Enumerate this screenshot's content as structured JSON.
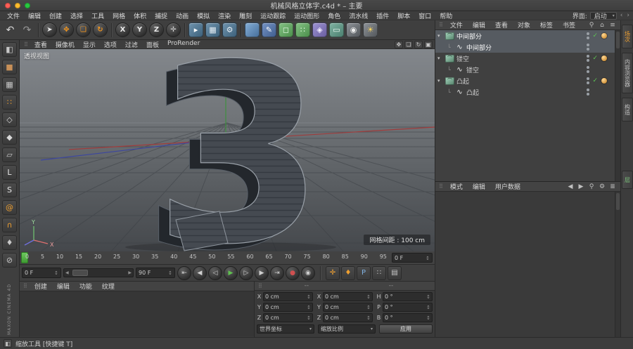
{
  "window": {
    "title": "机械风格立体字.c4d * – 主要",
    "status_tool": "缩放工具 [快捷键 T]",
    "traffic_lights": [
      "#ff5f57",
      "#febc2e",
      "#28c840"
    ]
  },
  "menubar": {
    "items": [
      "文件",
      "编辑",
      "创建",
      "选择",
      "工具",
      "网格",
      "体积",
      "捕捉",
      "动画",
      "模拟",
      "渲染",
      "雕刻",
      "运动跟踪",
      "运动图形",
      "角色",
      "流水线",
      "插件",
      "脚本",
      "窗口",
      "帮助"
    ],
    "interface_label": "界面:",
    "interface_value": "启动"
  },
  "toolbar": {
    "undo": [
      {
        "name": "undo-button",
        "glyph": "↶",
        "color": "#d8d8d8",
        "kind": "flat"
      },
      {
        "name": "redo-button",
        "glyph": "↷",
        "color": "#999999",
        "kind": "flat"
      }
    ],
    "tools": [
      {
        "name": "live-selection-button",
        "glyph": "➤",
        "color": "#e8e8e8",
        "kind": "round"
      },
      {
        "name": "move-button",
        "glyph": "✥",
        "color": "#f0941e",
        "kind": "round"
      },
      {
        "name": "scale-button",
        "glyph": "❏",
        "color": "#f0941e",
        "kind": "round"
      },
      {
        "name": "rotate-button",
        "glyph": "↻",
        "color": "#f0941e",
        "kind": "round"
      }
    ],
    "axis": [
      {
        "name": "x-lock-button",
        "glyph": "X",
        "color": "#e8e8e8",
        "kind": "round"
      },
      {
        "name": "y-lock-button",
        "glyph": "Y",
        "color": "#e8e8e8",
        "kind": "round"
      },
      {
        "name": "z-lock-button",
        "glyph": "Z",
        "color": "#e8e8e8",
        "kind": "round"
      },
      {
        "name": "coord-system-button",
        "glyph": "✛",
        "color": "#d0d0d0",
        "kind": "round"
      }
    ],
    "render": [
      {
        "name": "render-view-button",
        "glyph": "▸",
        "color": "#ffffff",
        "bg": "linear-gradient(135deg,#6f93ad,#3d617b)",
        "kind": "obj"
      },
      {
        "name": "render-picture-button",
        "glyph": "▦",
        "color": "#e6eef4",
        "bg": "linear-gradient(135deg,#6f93ad,#3d617b)",
        "kind": "obj"
      },
      {
        "name": "render-settings-button",
        "glyph": "⚙",
        "color": "#e6eef4",
        "bg": "linear-gradient(135deg,#6f93ad,#3d617b)",
        "kind": "obj"
      }
    ],
    "objects": [
      {
        "name": "add-cube-button",
        "glyph": "",
        "color": "#ffffff",
        "bg": "linear-gradient(135deg,#84aed6,#48709c)",
        "kind": "obj"
      },
      {
        "name": "add-spline-button",
        "glyph": "✎",
        "color": "#ffffff",
        "bg": "linear-gradient(135deg,#7492c4,#415f90)",
        "kind": "obj"
      },
      {
        "name": "add-subdivision-button",
        "glyph": "◻",
        "color": "#eaffea",
        "bg": "linear-gradient(135deg,#84c284,#4c8f4c)",
        "kind": "obj"
      },
      {
        "name": "add-array-button",
        "glyph": "∷",
        "color": "#eaffea",
        "bg": "linear-gradient(135deg,#84c284,#4c8f4c)",
        "kind": "obj"
      },
      {
        "name": "add-deformer-button",
        "glyph": "◈",
        "color": "#f2ecff",
        "bg": "linear-gradient(135deg,#9d92d2,#6a5fa2)",
        "kind": "obj"
      },
      {
        "name": "add-environment-button",
        "glyph": "▭",
        "color": "#eaf8f2",
        "bg": "linear-gradient(135deg,#7fb3a2,#4c8070)",
        "kind": "obj"
      },
      {
        "name": "add-camera-button",
        "glyph": "◉",
        "color": "#ececec",
        "bg": "linear-gradient(135deg,#8d9297,#54585c)",
        "kind": "obj"
      },
      {
        "name": "add-light-button",
        "glyph": "☀",
        "color": "#ffd75a",
        "bg": "linear-gradient(135deg,#8d9297,#54585c)",
        "kind": "obj"
      }
    ]
  },
  "sidebar": {
    "tools": [
      {
        "name": "make-editable-button",
        "glyph": "◧",
        "color": "#c8c8c8"
      },
      {
        "name": "model-mode-button",
        "glyph": "■",
        "color": "#c89058"
      },
      {
        "name": "texture-mode-button",
        "glyph": "▦",
        "color": "#c8c8c8"
      },
      {
        "name": "points-mode-button",
        "glyph": "∷",
        "color": "#f0a030"
      },
      {
        "name": "edges-mode-button",
        "glyph": "◇",
        "color": "#d8d8d8"
      },
      {
        "name": "polygons-mode-button",
        "glyph": "◆",
        "color": "#d8d8d8"
      },
      {
        "name": "workplane-mode-button",
        "glyph": "▱",
        "color": "#c8c8c8"
      },
      {
        "name": "axis-mode-button",
        "glyph": "L",
        "color": "#e8e8e8"
      },
      {
        "name": "soft-selection-button",
        "glyph": "S",
        "color": "#e8e8e8"
      },
      {
        "name": "tweak-mode-button",
        "glyph": "@",
        "color": "#f0a030"
      },
      {
        "name": "snap-button",
        "glyph": "∩",
        "color": "#f0a030"
      },
      {
        "name": "keyframe-mode-button",
        "glyph": "♦",
        "color": "#c8c8c8"
      },
      {
        "name": "lock-button",
        "glyph": "⊘",
        "color": "#c8c8c8"
      }
    ]
  },
  "viewport": {
    "menu": [
      "查看",
      "摄像机",
      "显示",
      "选项",
      "过滤",
      "面板",
      "ProRender"
    ],
    "nav": [
      {
        "name": "pan-view-icon",
        "glyph": "✥"
      },
      {
        "name": "zoom-view-icon",
        "glyph": "❏"
      },
      {
        "name": "rotate-view-icon",
        "glyph": "↻"
      },
      {
        "name": "maximize-view-icon",
        "glyph": "▣"
      }
    ],
    "label": "透视视图",
    "grid_info": "网格间距 : 100 cm",
    "model_char": "3",
    "axis": {
      "x": "X",
      "y": "Y"
    }
  },
  "timeline": {
    "ticks": [
      "0",
      "5",
      "10",
      "15",
      "20",
      "25",
      "30",
      "35",
      "40",
      "45",
      "50",
      "55",
      "60",
      "65",
      "70",
      "75",
      "80",
      "85",
      "90",
      "95"
    ],
    "frame_box": "0 F",
    "current": "0 F",
    "range_end": "90 F",
    "transport": [
      {
        "name": "goto-start-button",
        "glyph": "⇤",
        "color": "#d0d0d0"
      },
      {
        "name": "prev-key-button",
        "glyph": "◀",
        "color": "#d0d0d0"
      },
      {
        "name": "prev-frame-button",
        "glyph": "◁",
        "color": "#d0d0d0"
      },
      {
        "name": "play-button",
        "glyph": "▶",
        "color": "#5fc14f"
      },
      {
        "name": "next-frame-button",
        "glyph": "▷",
        "color": "#d0d0d0"
      },
      {
        "name": "next-key-button",
        "glyph": "▶",
        "color": "#d0d0d0"
      },
      {
        "name": "goto-end-button",
        "glyph": "⇥",
        "color": "#d0d0d0"
      },
      {
        "name": "record-objects-button",
        "glyph": "●",
        "color": "#d05050"
      },
      {
        "name": "autokey-button",
        "glyph": "◉",
        "color": "#d0d0d0"
      }
    ],
    "key_tools": [
      {
        "name": "record-position-button",
        "glyph": "✛",
        "color": "#f0a030"
      },
      {
        "name": "record-key-button",
        "glyph": "♦",
        "color": "#f0a030"
      },
      {
        "name": "pla-button",
        "glyph": "P",
        "color": "#7fb0e0"
      },
      {
        "name": "keyframe-selection-button",
        "glyph": "∷",
        "color": "#c8c8c8"
      },
      {
        "name": "motion-clip-button",
        "glyph": "▤",
        "color": "#c8c8c8"
      }
    ]
  },
  "material_manager": {
    "tabs": [
      "创建",
      "编辑",
      "功能",
      "纹理"
    ]
  },
  "coordinates": {
    "dashes": [
      "--",
      "--"
    ],
    "rows": [
      {
        "pl": "X",
        "pv": "0 cm",
        "sl": "X",
        "sv": "0 cm",
        "rl": "H",
        "rv": "0 °"
      },
      {
        "pl": "Y",
        "pv": "0 cm",
        "sl": "Y",
        "sv": "0 cm",
        "rl": "P",
        "rv": "0 °"
      },
      {
        "pl": "Z",
        "pv": "0 cm",
        "sl": "Z",
        "sv": "0 cm",
        "rl": "B",
        "rv": "0 °"
      }
    ],
    "space_dropdown": "世界坐标",
    "size_dropdown": "缩放比例",
    "apply_label": "应用"
  },
  "object_manager": {
    "tabs": [
      "文件",
      "编辑",
      "查看",
      "对象",
      "标签",
      "书签"
    ],
    "header_icons": [
      {
        "name": "search-icon",
        "glyph": "⚲"
      },
      {
        "name": "path-icon",
        "glyph": "⌂"
      },
      {
        "name": "menu-icon",
        "glyph": "≡"
      }
    ],
    "objects": [
      {
        "name": "中间部分"
      },
      {
        "name": "中间部分"
      },
      {
        "name": "镂空"
      },
      {
        "name": "镂空"
      },
      {
        "name": "凸起"
      },
      {
        "name": "凸起"
      }
    ]
  },
  "attribute_manager": {
    "tabs": [
      "模式",
      "编辑",
      "用户数据"
    ],
    "header_icons": [
      {
        "name": "back-icon",
        "glyph": "◀"
      },
      {
        "name": "forward-icon",
        "glyph": "▶"
      },
      {
        "name": "search-icon",
        "glyph": "⚲"
      },
      {
        "name": "gear-icon",
        "glyph": "⚙"
      },
      {
        "name": "menu-icon",
        "glyph": "≣"
      }
    ]
  },
  "right_strip": {
    "tabs": [
      {
        "label": "场次",
        "color": "#f0a030"
      },
      {
        "label": "内容浏览器",
        "color": "#c0c0c0"
      },
      {
        "label": "构造",
        "color": "#c0c0c0"
      },
      {
        "label": "层",
        "color": "#7fc87f"
      }
    ]
  },
  "brand": {
    "line1": "MAXON",
    "line2": "CINEMA 4D"
  },
  "colors": {
    "accent": "#f0941e",
    "play": "#5fc14f",
    "check": "#59c151"
  }
}
